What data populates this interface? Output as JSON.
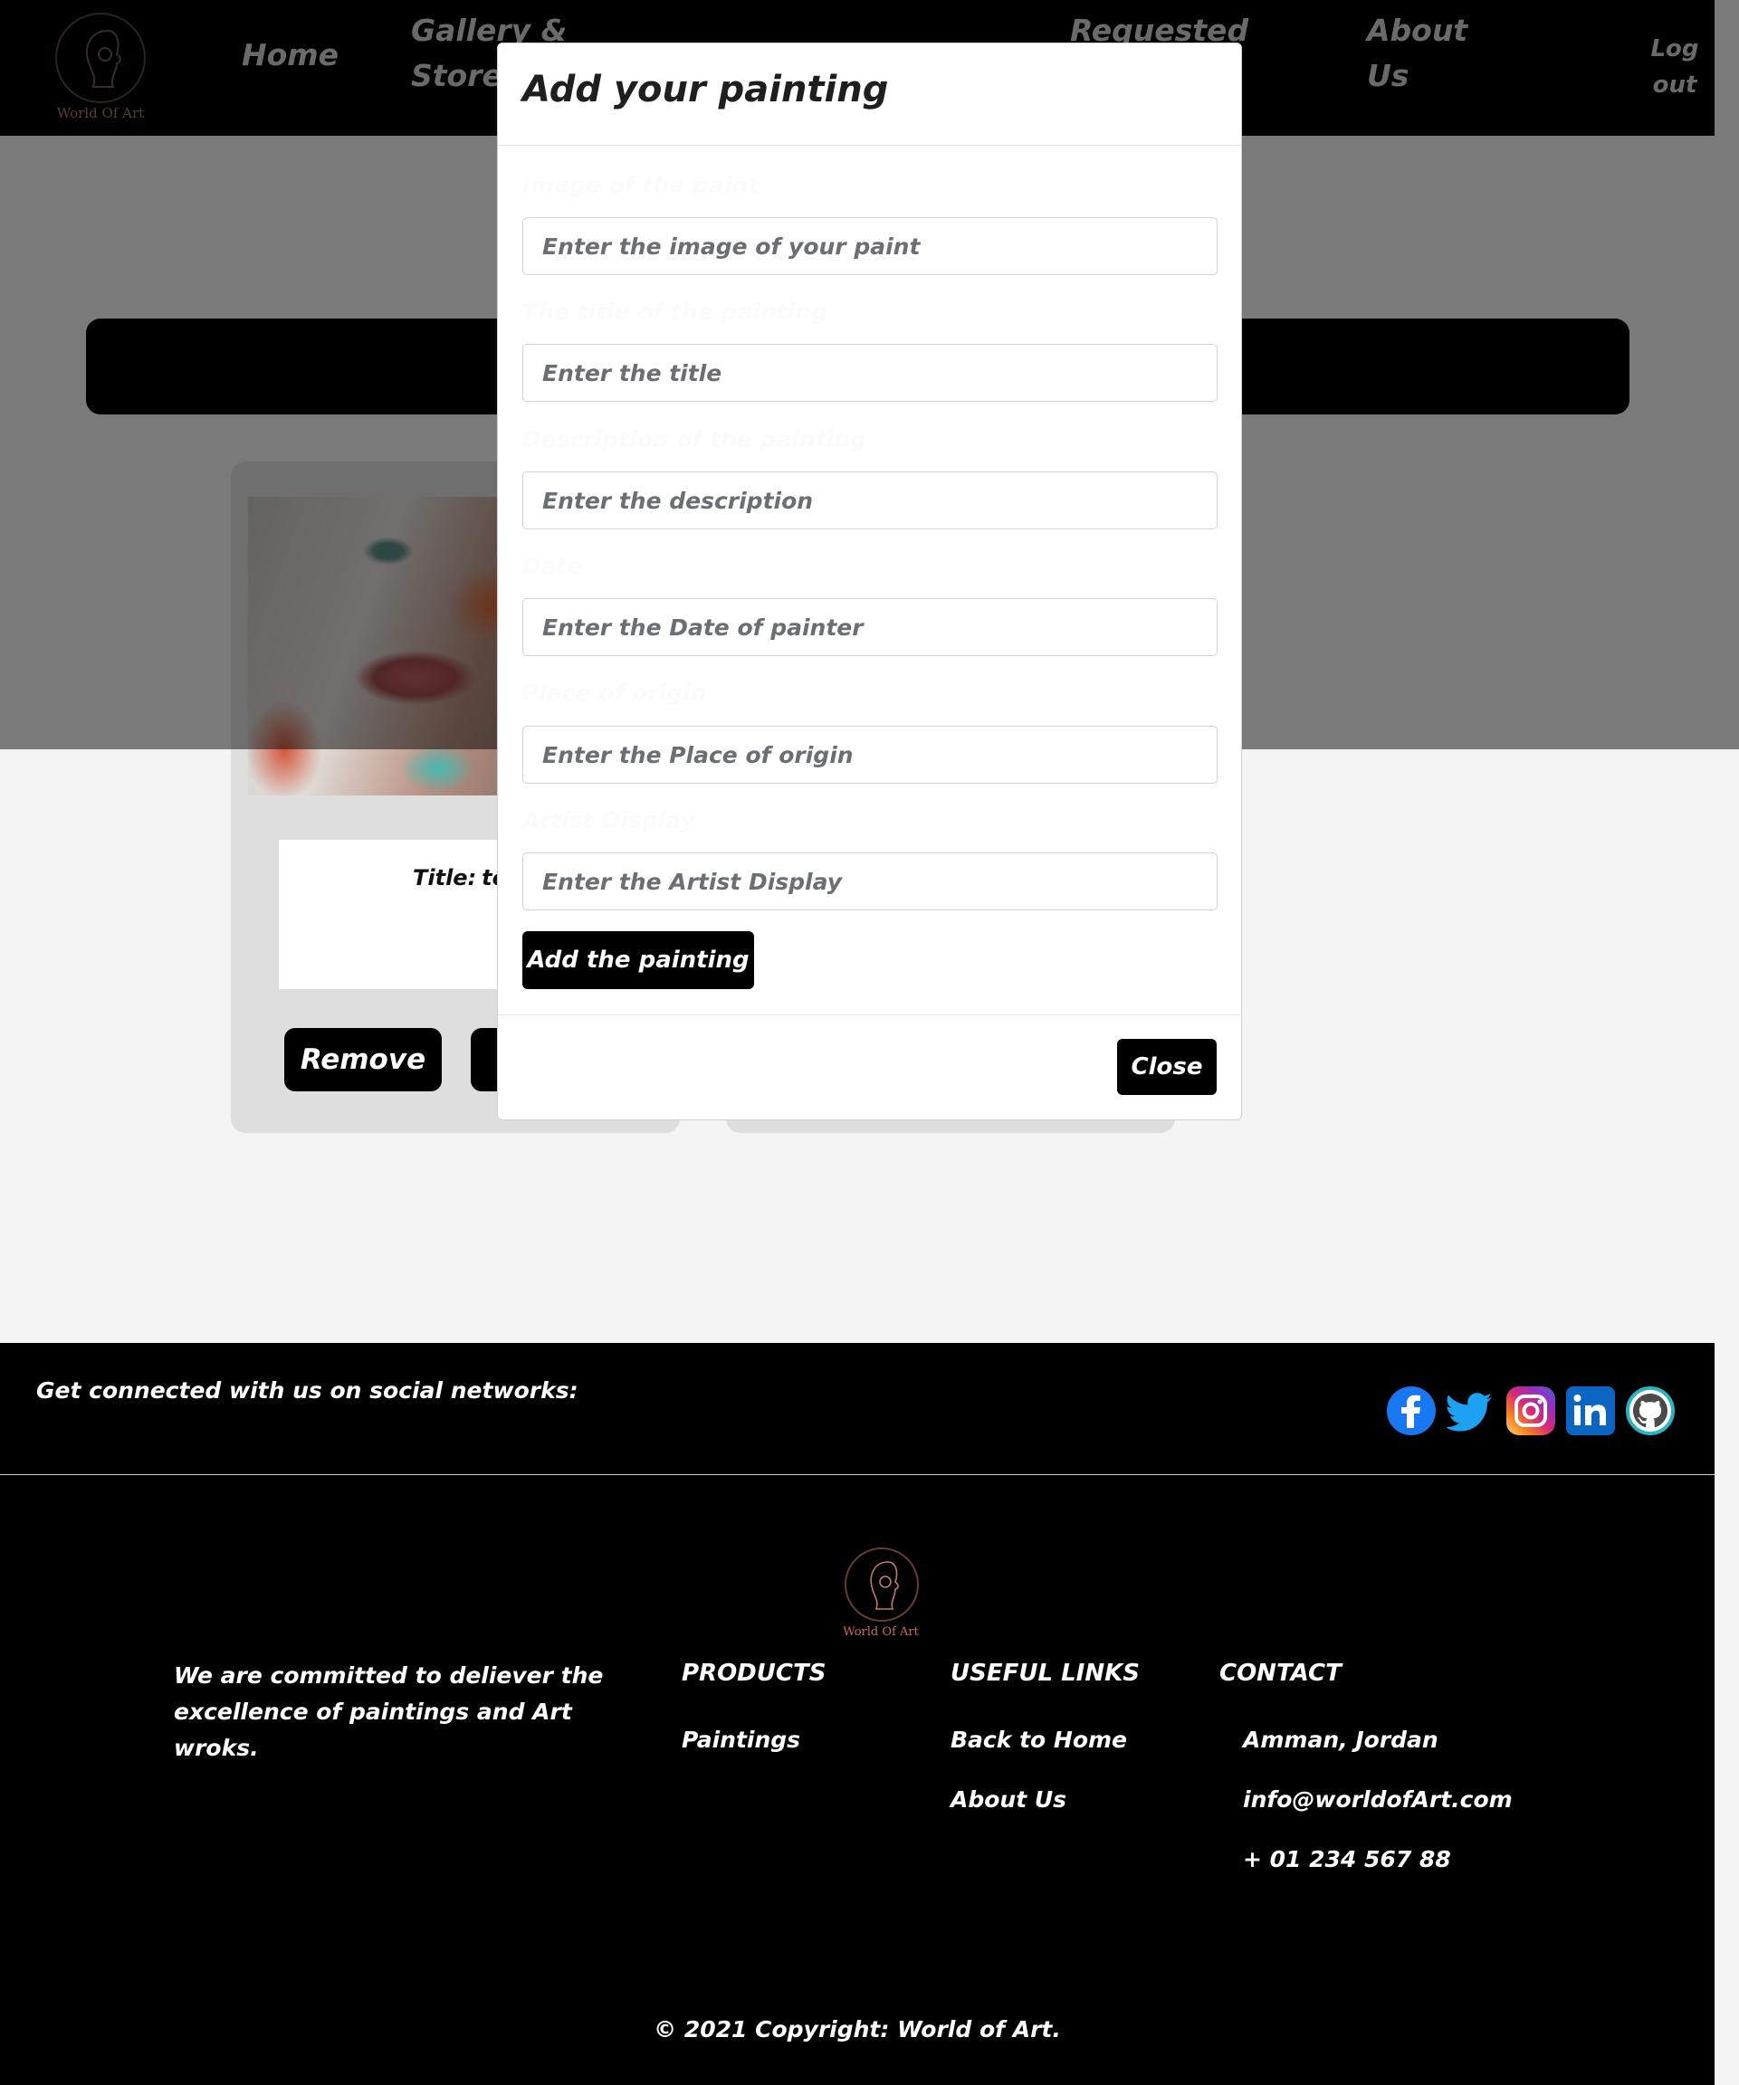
{
  "navbar": {
    "logo_caption": "World Of Art",
    "links": [
      {
        "label": "Home"
      },
      {
        "label": "Gallery &\nStore"
      },
      {
        "label": "Requested"
      },
      {
        "label": "About\nUs"
      }
    ],
    "logout_label": "Log\nout"
  },
  "card": {
    "title_label": "Title:",
    "title_value": "te",
    "remove_label": "Remove"
  },
  "modal": {
    "title": "Add your painting",
    "fields": [
      {
        "label": "Image of the paint",
        "placeholder": "Enter the image of your paint",
        "value": ""
      },
      {
        "label": "The title of the painting",
        "placeholder": "Enter the title",
        "value": ""
      },
      {
        "label": "Description of the painting",
        "placeholder": "Enter the description",
        "value": ""
      },
      {
        "label": "Date",
        "placeholder": "Enter the Date of painter",
        "value": ""
      },
      {
        "label": "Place of origin",
        "placeholder": "Enter the Place of origin",
        "value": ""
      },
      {
        "label": "Artist Display",
        "placeholder": "Enter the Artist Display",
        "value": ""
      }
    ],
    "submit_label": "Add the painting",
    "close_label": "Close"
  },
  "footer": {
    "social_text": "Get connected with us on social networks:",
    "social_icons": [
      {
        "name": "facebook-icon",
        "glyph": "f",
        "color": "#1877f2"
      },
      {
        "name": "twitter-icon",
        "glyph": "t",
        "color": "#1da1f2"
      },
      {
        "name": "instagram-icon",
        "glyph": "◎",
        "color": "#d6249f"
      },
      {
        "name": "linkedin-icon",
        "glyph": "in",
        "color": "#0a66c2"
      },
      {
        "name": "github-icon",
        "glyph": "●",
        "color": "#27b5c3"
      }
    ],
    "logo_caption": "World Of Art",
    "about_text": "We are committed to deliever the excellence of paintings and Art wroks.",
    "products": {
      "heading": "PRODUCTS",
      "links": [
        "Paintings"
      ]
    },
    "useful_links": {
      "heading": "USEFUL LINKS",
      "links": [
        "Back to Home",
        "About Us"
      ]
    },
    "contact": {
      "heading": "CONTACT",
      "items": [
        "Amman, Jordan",
        "info@worldofArt.com",
        "+ 01 234 567 88"
      ]
    },
    "copyright": "© 2021 Copyright: World of Art."
  }
}
